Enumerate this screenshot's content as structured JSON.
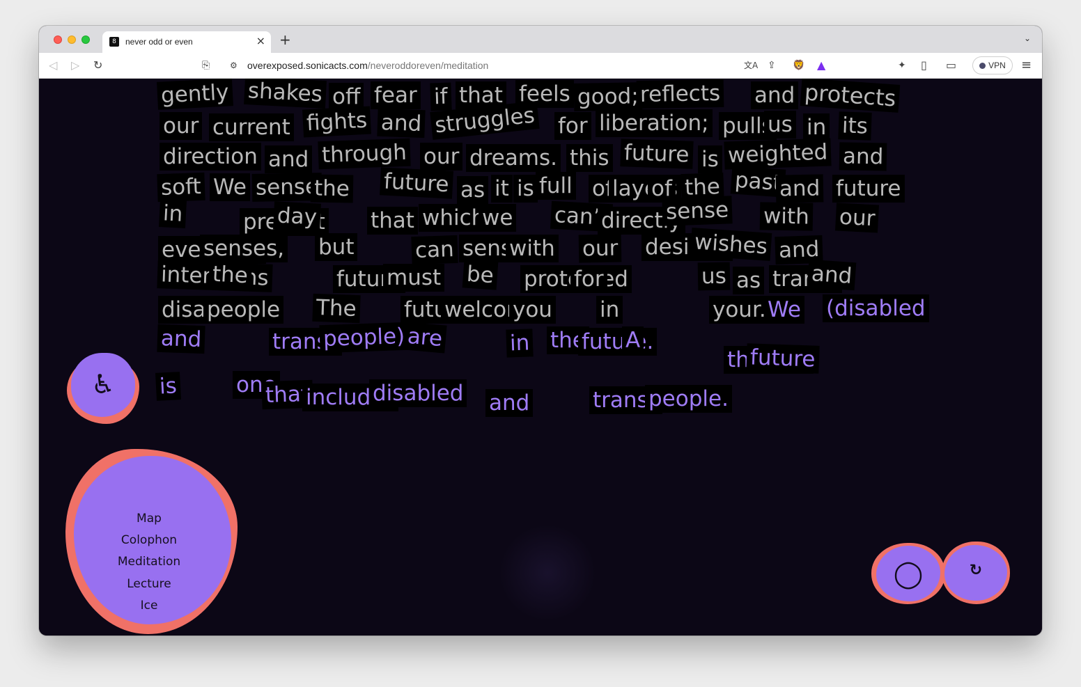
{
  "browser": {
    "tab_title": "never odd or even",
    "tab_favicon": "8",
    "new_tab": "+",
    "tab_close": "×",
    "tab_menu": "⌄",
    "url_host": "overexposed.sonicacts.com",
    "url_path": "/neveroddoreven/meditation",
    "vpn_label": "VPN",
    "icons": {
      "back": "◁",
      "forward": "▷",
      "reload": "↻",
      "bookmark": "⎘",
      "site_info": "⚙",
      "translate": "文A",
      "share": "⇪",
      "brave": "🦁",
      "rewards": "▲",
      "leo": "✦",
      "sidebar": "▯",
      "wallet": "▭",
      "menu": "≡"
    }
  },
  "meditation": {
    "words": [
      "gently",
      "shakes",
      "off",
      "fear",
      "if",
      "that",
      "feels",
      "good;",
      "reflects",
      "and",
      "protects",
      "our",
      "current",
      "fights",
      "and",
      "struggles",
      "for",
      "liberation;",
      "pulls",
      "us",
      "in",
      "its",
      "direction",
      "and",
      "through",
      "our",
      "dreams.",
      "this",
      "future",
      "is",
      "weighted",
      "and",
      "soft",
      "We",
      "sense",
      "the",
      "future",
      "as",
      "it",
      "is",
      "full",
      "of",
      "layers",
      "of",
      "the",
      "past",
      "and",
      "future",
      "in",
      "present",
      "day",
      "that",
      "which",
      "we",
      "can’t",
      "directly",
      "sense",
      "with",
      "our",
      "everyday",
      "senses,",
      "but",
      "can",
      "sense",
      "with",
      "our",
      "desires,",
      "wishes",
      "and",
      "intentions",
      "the",
      "future",
      "must",
      "be",
      "protected",
      "for",
      "us",
      "as",
      "trans*",
      "and",
      "disabled",
      "people",
      "The",
      "future",
      "welcomes",
      "you",
      "in",
      "your...",
      "We",
      "(disabled",
      "and",
      "trans*",
      "people)",
      "are",
      "in",
      "the",
      "future.",
      "A",
      "thriving",
      "future",
      "is",
      "one",
      "that",
      "includes",
      "disabled",
      "and",
      "trans*",
      "people."
    ],
    "highlight_from_index": 88
  },
  "accessibility_button": {
    "icon": "♿",
    "label": "accessibility"
  },
  "nav": {
    "items": [
      "Map",
      "Colophon",
      "Meditation",
      "Lecture",
      "Ice"
    ]
  },
  "controls": {
    "circle_icon": "◯",
    "replay_icon": "↻"
  },
  "colors": {
    "background": "#0c0716",
    "text": "#b9b9b9",
    "highlight": "#9f7cf6",
    "blob_purple": "#9870f0",
    "blob_coral": "#f07167"
  }
}
